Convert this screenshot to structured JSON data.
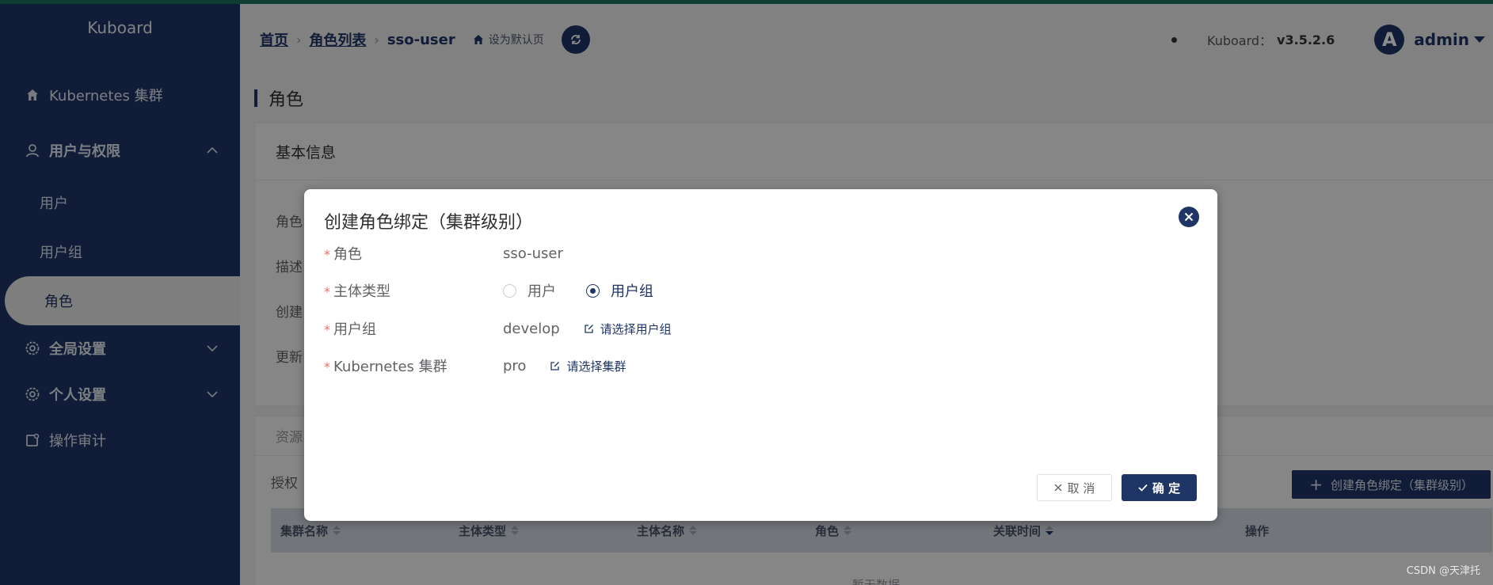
{
  "sidebar": {
    "brand": "Kuboard",
    "items": [
      {
        "label": "Kubernetes 集群",
        "icon": "home-icon"
      },
      {
        "label": "用户与权限",
        "icon": "user-icon",
        "expanded": true
      },
      {
        "label": "全局设置",
        "icon": "gear-icon"
      },
      {
        "label": "个人设置",
        "icon": "gear-icon"
      },
      {
        "label": "操作审计",
        "icon": "audit-icon"
      }
    ],
    "sub_items": [
      {
        "label": "用户"
      },
      {
        "label": "用户组"
      },
      {
        "label": "角色",
        "active": true
      }
    ]
  },
  "header": {
    "breadcrumb": [
      "首页",
      "角色列表",
      "sso-user"
    ],
    "set_default": "设为默认页",
    "version_label": "Kuboard：",
    "version_value": "v3.5.2.6",
    "avatar_letter": "A",
    "user": "admin"
  },
  "page": {
    "title": "角色",
    "basic_info_title": "基本信息",
    "fields": [
      "角色",
      "描述",
      "创建",
      "更新"
    ],
    "resources_tab": "资源",
    "auth_label": "授权",
    "create_binding_button": "创建角色绑定（集群级别）",
    "table_headers": [
      "集群名称",
      "主体类型",
      "主体名称",
      "角色",
      "关联时间",
      "操作"
    ],
    "empty_text": "暂无数据"
  },
  "dialog": {
    "title": "创建角色绑定（集群级别）",
    "role_label": "角色",
    "role_value": "sso-user",
    "subject_type_label": "主体类型",
    "radio_user": "用户",
    "radio_group": "用户组",
    "selected_subject_type": "用户组",
    "group_label": "用户组",
    "group_value": "develop",
    "pick_group": "请选择用户组",
    "cluster_label": "Kubernetes 集群",
    "cluster_value": "pro",
    "pick_cluster": "请选择集群",
    "cancel": "取 消",
    "ok": "确 定"
  },
  "watermark": "CSDN @天津托",
  "colors": {
    "primary": "#1f3566",
    "required": "#f56c6c",
    "topline": "#1e6f5c"
  }
}
